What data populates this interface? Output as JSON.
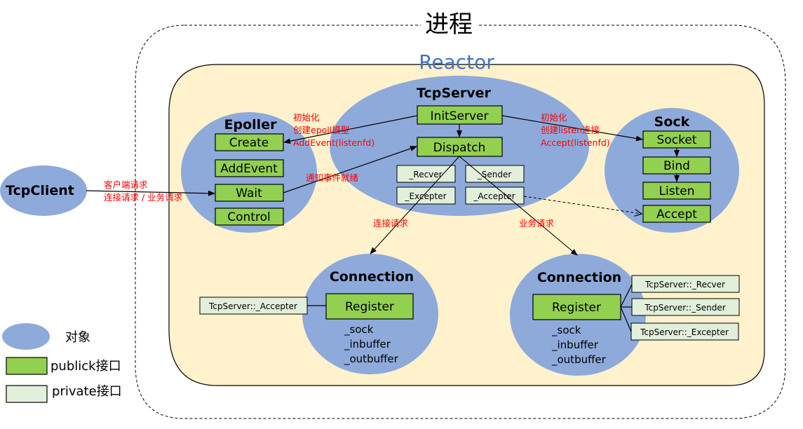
{
  "title": "进程",
  "reactor_label": "Reactor",
  "colors": {
    "object": "#8eaadb",
    "public": "#92d050",
    "private": "#e2efda",
    "reactor_bg": "#fff2cc",
    "reactor_title": "#4472c4",
    "annotation": "#ff0000"
  },
  "client": {
    "name": "TcpClient"
  },
  "client_annotation": [
    "客户端请求",
    "连接请求 / 业务请求"
  ],
  "tcpserver": {
    "name": "TcpServer",
    "public": [
      "InitServer",
      "Dispatch"
    ],
    "private": [
      "_Recver",
      "_Sender",
      "_Excepter",
      "_Accepter"
    ]
  },
  "epoller": {
    "name": "Epoller",
    "public": [
      "Create",
      "AddEvent",
      "Wait",
      "Control"
    ]
  },
  "sock": {
    "name": "Sock",
    "public": [
      "Socket",
      "Bind",
      "Listen",
      "Accept"
    ]
  },
  "init_left_annotation": [
    "初始化",
    "创建epoll模型",
    "AddEvent(listenfd)"
  ],
  "init_right_annotation": [
    "初始化",
    "创建listen连接",
    "Accept(listenfd)"
  ],
  "notify_annotation": "通知事件就绪",
  "connect_annotation": "连接请求",
  "business_annotation": "业务请求",
  "connection_left": {
    "name": "Connection",
    "public": "Register",
    "members": [
      "_sock",
      "_inbuffer",
      "_outbuffer"
    ],
    "linked": [
      "TcpServer::_Accepter"
    ]
  },
  "connection_right": {
    "name": "Connection",
    "public": "Register",
    "members": [
      "_sock",
      "_inbuffer",
      "_outbuffer"
    ],
    "linked": [
      "TcpServer::_Recver",
      "TcpServer::_Sender",
      "TcpServer::_Excepter"
    ]
  },
  "legend": {
    "object": "对象",
    "public": "publick接口",
    "private": "private接口"
  }
}
